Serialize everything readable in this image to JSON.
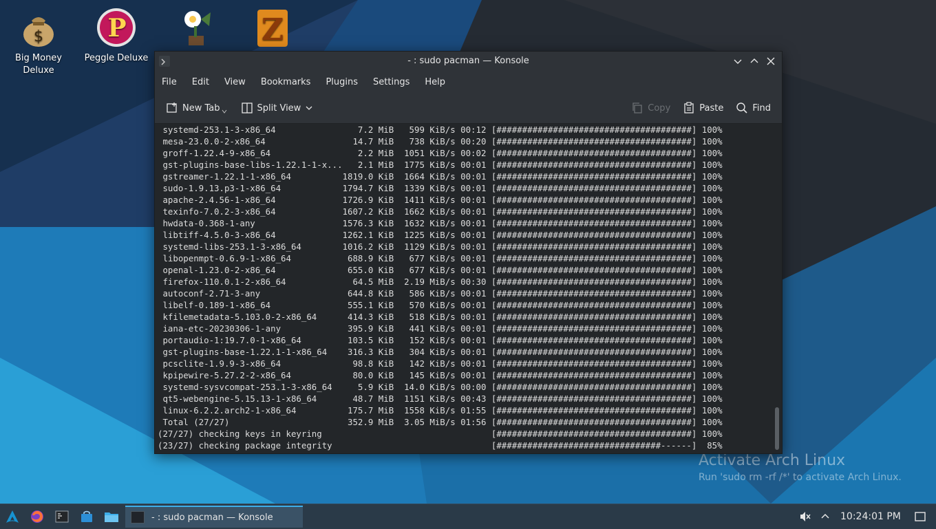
{
  "desktop": {
    "icons": [
      {
        "label_line1": "Big Money",
        "label_line2": "Deluxe",
        "icon": "money-bag-icon"
      },
      {
        "label_line1": "Peggle Deluxe",
        "label_line2": "",
        "icon": "peggle-icon"
      },
      {
        "label_line1": "",
        "label_line2": "",
        "icon": "plants-vs-zombies-icon"
      },
      {
        "label_line1": "",
        "label_line2": "",
        "icon": "zuma-icon"
      }
    ],
    "watermark": {
      "title": "Activate Arch Linux",
      "subtitle": "Run 'sudo rm -rf /*' to activate Arch Linux."
    }
  },
  "window": {
    "title": "- : sudo pacman — Konsole",
    "menu": [
      "File",
      "Edit",
      "View",
      "Bookmarks",
      "Plugins",
      "Settings",
      "Help"
    ],
    "toolbar": {
      "new_tab": "New Tab",
      "split_view": "Split View",
      "copy": "Copy",
      "paste": "Paste",
      "find": "Find"
    }
  },
  "terminal": {
    "lines": [
      " systemd-253.1-3-x86_64                7.2 MiB   599 KiB/s 00:12 [######################################] 100%",
      " mesa-23.0.0-2-x86_64                 14.7 MiB   738 KiB/s 00:20 [######################################] 100%",
      " groff-1.22.4-9-x86_64                 2.2 MiB  1051 KiB/s 00:02 [######################################] 100%",
      " gst-plugins-base-libs-1.22.1-1-x...   2.1 MiB  1775 KiB/s 00:01 [######################################] 100%",
      " gstreamer-1.22.1-1-x86_64          1819.0 KiB  1664 KiB/s 00:01 [######################################] 100%",
      " sudo-1.9.13.p3-1-x86_64            1794.7 KiB  1339 KiB/s 00:01 [######################################] 100%",
      " apache-2.4.56-1-x86_64             1726.9 KiB  1411 KiB/s 00:01 [######################################] 100%",
      " texinfo-7.0.2-3-x86_64             1607.2 KiB  1662 KiB/s 00:01 [######################################] 100%",
      " hwdata-0.368-1-any                 1576.3 KiB  1632 KiB/s 00:01 [######################################] 100%",
      " libtiff-4.5.0-3-x86_64             1262.1 KiB  1225 KiB/s 00:01 [######################################] 100%",
      " systemd-libs-253.1-3-x86_64        1016.2 KiB  1129 KiB/s 00:01 [######################################] 100%",
      " libopenmpt-0.6.9-1-x86_64           688.9 KiB   677 KiB/s 00:01 [######################################] 100%",
      " openal-1.23.0-2-x86_64              655.0 KiB   677 KiB/s 00:01 [######################################] 100%",
      " firefox-110.0.1-2-x86_64             64.5 MiB  2.19 MiB/s 00:30 [######################################] 100%",
      " autoconf-2.71-3-any                 644.8 KiB   586 KiB/s 00:01 [######################################] 100%",
      " libelf-0.189-1-x86_64               555.1 KiB   570 KiB/s 00:01 [######################################] 100%",
      " kfilemetadata-5.103.0-2-x86_64      414.3 KiB   518 KiB/s 00:01 [######################################] 100%",
      " iana-etc-20230306-1-any             395.9 KiB   441 KiB/s 00:01 [######################################] 100%",
      " portaudio-1:19.7.0-1-x86_64         103.5 KiB   152 KiB/s 00:01 [######################################] 100%",
      " gst-plugins-base-1.22.1-1-x86_64    316.3 KiB   304 KiB/s 00:01 [######################################] 100%",
      " pcsclite-1.9.9-3-x86_64              98.8 KiB   142 KiB/s 00:01 [######################################] 100%",
      " kpipewire-5.27.2-2-x86_64            80.0 KiB   145 KiB/s 00:01 [######################################] 100%",
      " systemd-sysvcompat-253.1-3-x86_64     5.9 KiB  14.0 KiB/s 00:00 [######################################] 100%",
      " qt5-webengine-5.15.13-1-x86_64       48.7 MiB  1151 KiB/s 00:43 [######################################] 100%",
      " linux-6.2.2.arch2-1-x86_64          175.7 MiB  1558 KiB/s 01:55 [######################################] 100%",
      " Total (27/27)                       352.9 MiB  3.05 MiB/s 01:56 [######################################] 100%",
      "(27/27) checking keys in keyring                                 [######################################] 100%",
      "(23/27) checking package integrity                               [################################------]  85%"
    ]
  },
  "taskbar": {
    "task_label": "- : sudo pacman — Konsole",
    "clock": "10:24:01 PM",
    "launchers": [
      "arch-menu-icon",
      "firefox-icon",
      "terminal-icon",
      "store-icon",
      "folder-icon"
    ],
    "tray": [
      "volume-muted-icon",
      "chevron-up-icon",
      "show-desktop-icon"
    ]
  },
  "colors": {
    "terminal_bg": "#232629",
    "terminal_fg": "#dcdcdc",
    "accent": "#3daee9",
    "taskbar": "#2a3a48"
  }
}
